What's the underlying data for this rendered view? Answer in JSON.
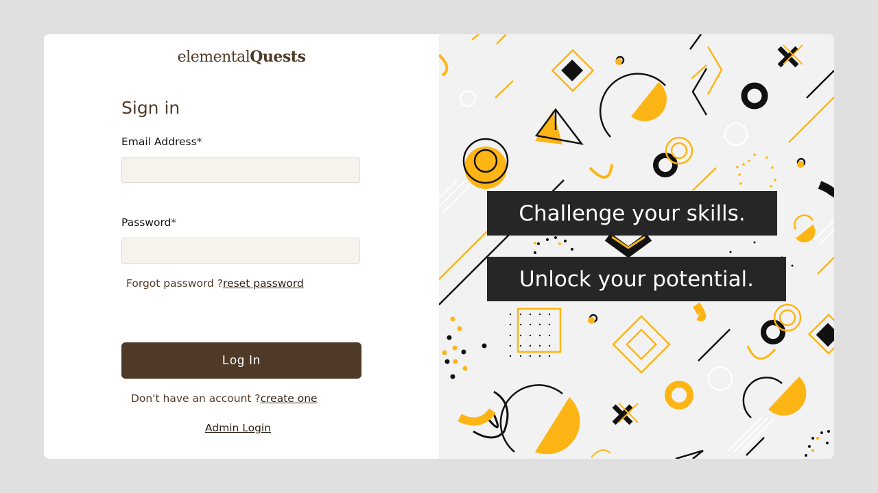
{
  "logo": {
    "part1": "elemental",
    "part2": "Quests"
  },
  "signin": {
    "title": "Sign in",
    "email_label": "Email Address",
    "password_label": "Password",
    "required_mark": "*",
    "email_value": "",
    "password_value": "",
    "forgot_text": "Forgot password ?",
    "reset_link": "reset password",
    "login_button": "Log In",
    "no_account_text": "Don't have an account ?",
    "create_link": "create one",
    "admin_link": "Admin Login"
  },
  "hero": {
    "line1": "Challenge your skills.",
    "line2": "Unlock your potential."
  },
  "colors": {
    "brand_brown": "#4f3a28",
    "accent_yellow": "#fdb515",
    "banner_dark": "#262626"
  }
}
